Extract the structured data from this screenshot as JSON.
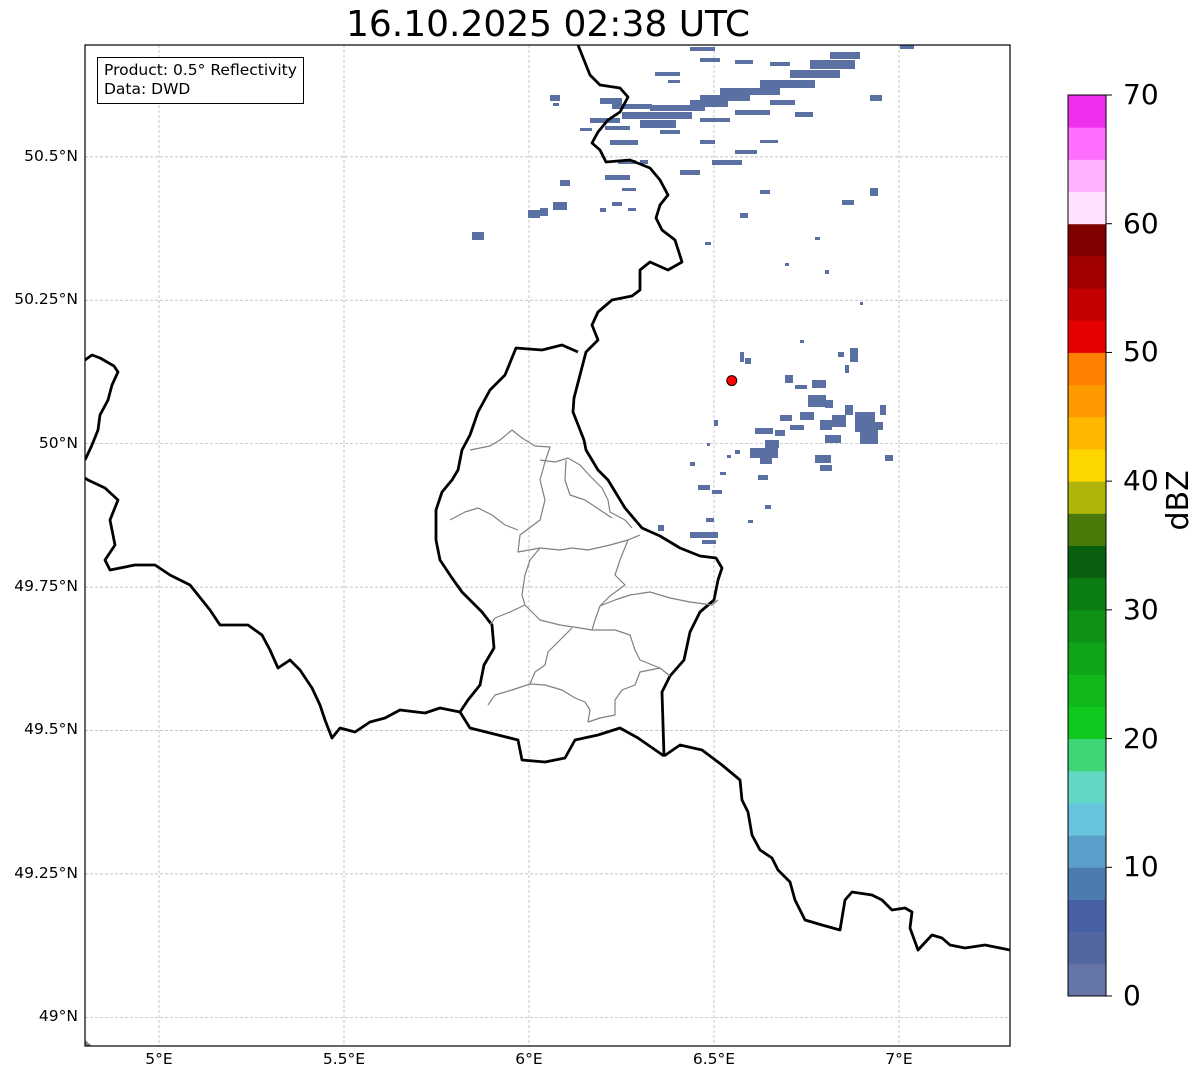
{
  "title": "16.10.2025 02:38 UTC",
  "info_box": {
    "product": "Product: 0.5° Reflectivity",
    "source": "Data: DWD"
  },
  "map": {
    "lon_range": [
      4.8,
      7.3
    ],
    "lat_range": [
      48.95,
      50.695
    ],
    "gridlines": true,
    "lat_ticks": [
      {
        "value": 50.5,
        "label": "50.5°N"
      },
      {
        "value": 50.25,
        "label": "50.25°N"
      },
      {
        "value": 50.0,
        "label": "50°N"
      },
      {
        "value": 49.75,
        "label": "49.75°N"
      },
      {
        "value": 49.5,
        "label": "49.5°N"
      },
      {
        "value": 49.25,
        "label": "49.25°N"
      },
      {
        "value": 49.0,
        "label": "49°N"
      }
    ],
    "lon_ticks": [
      {
        "value": 5.0,
        "label": "5°E"
      },
      {
        "value": 5.5,
        "label": "5.5°E"
      },
      {
        "value": 6.0,
        "label": "6°E"
      },
      {
        "value": 6.5,
        "label": "6.5°E"
      },
      {
        "value": 7.0,
        "label": "7°E"
      }
    ],
    "radar_site": {
      "lon": 6.548,
      "lat": 50.11,
      "color": "#ff0000"
    },
    "border_color": "#000000",
    "district_color": "#808080",
    "echo_color": "#5a70a3"
  },
  "colorbar": {
    "unit": "dBZ",
    "min": 0,
    "max": 70,
    "step": 2.5,
    "tick_labels": [
      {
        "value": 0,
        "label": "0"
      },
      {
        "value": 10,
        "label": "10"
      },
      {
        "value": 20,
        "label": "20"
      },
      {
        "value": 30,
        "label": "30"
      },
      {
        "value": 40,
        "label": "40"
      },
      {
        "value": 50,
        "label": "50"
      },
      {
        "value": 60,
        "label": "60"
      },
      {
        "value": 70,
        "label": "70"
      }
    ],
    "colors": [
      "#6575a8",
      "#5266a0",
      "#4660a3",
      "#4b7bb1",
      "#5a9fc9",
      "#68c4dc",
      "#60d8c4",
      "#3ed574",
      "#11c81e",
      "#10b81a",
      "#10a518",
      "#0e9316",
      "#0b7d13",
      "#085f0d",
      "#4a7a0a",
      "#aeb40a",
      "#ffd700",
      "#ffb800",
      "#ff9900",
      "#ff7f00",
      "#e60000",
      "#c40000",
      "#a00000",
      "#800000",
      "#ffe2ff",
      "#ffb2ff",
      "#ff6eff",
      "#ee30ee"
    ]
  }
}
